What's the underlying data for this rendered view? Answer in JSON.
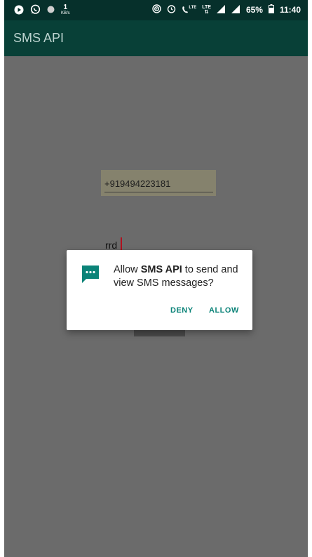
{
  "status_bar": {
    "left_icons": [
      "play-icon",
      "whatsapp-icon",
      "dot-icon"
    ],
    "net_speed_value": "1",
    "net_speed_unit": "KB/s",
    "lte_label_1": "LTE",
    "lte_label_2": "LTE",
    "battery_percent": "65%",
    "time": "11:40"
  },
  "app_bar": {
    "title": "SMS API"
  },
  "form": {
    "phone_value": "+919494223181",
    "message_value": "rrd"
  },
  "dialog": {
    "icon": "sms-message-icon",
    "prefix": "Allow ",
    "app_name": "SMS API",
    "suffix": " to send and view SMS messages?",
    "deny_label": "DENY",
    "allow_label": "ALLOW"
  },
  "colors": {
    "status_bar": "#06302b",
    "app_bar": "#084037",
    "accent": "#0b8378",
    "scrim_background": "#6b6b6b"
  }
}
